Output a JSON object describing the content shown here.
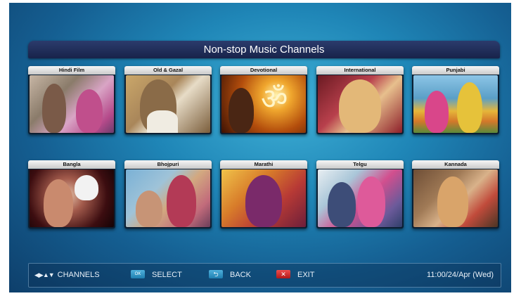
{
  "header": {
    "title": "Non-stop Music Channels"
  },
  "channels": [
    {
      "label": "Hindi Film"
    },
    {
      "label": "Old & Gazal"
    },
    {
      "label": "Devotional"
    },
    {
      "label": "International"
    },
    {
      "label": "Punjabi"
    },
    {
      "label": "Bangla"
    },
    {
      "label": "Bhojpuri"
    },
    {
      "label": "Marathi"
    },
    {
      "label": "Telgu"
    },
    {
      "label": "Kannada"
    }
  ],
  "footer": {
    "channels_label": "CHANNELS",
    "arrows_glyph": "◀▶▲▼",
    "ok_badge": "OK",
    "select_label": "SELECT",
    "back_badge": "⮌",
    "back_label": "BACK",
    "exit_badge": "✕",
    "exit_label": "EXIT",
    "datetime": "11:00/24/Apr (Wed)"
  },
  "icons": {
    "navigation": "arrow-keys-icon",
    "ok": "ok-button-icon",
    "back": "back-button-icon",
    "exit": "exit-button-icon"
  }
}
